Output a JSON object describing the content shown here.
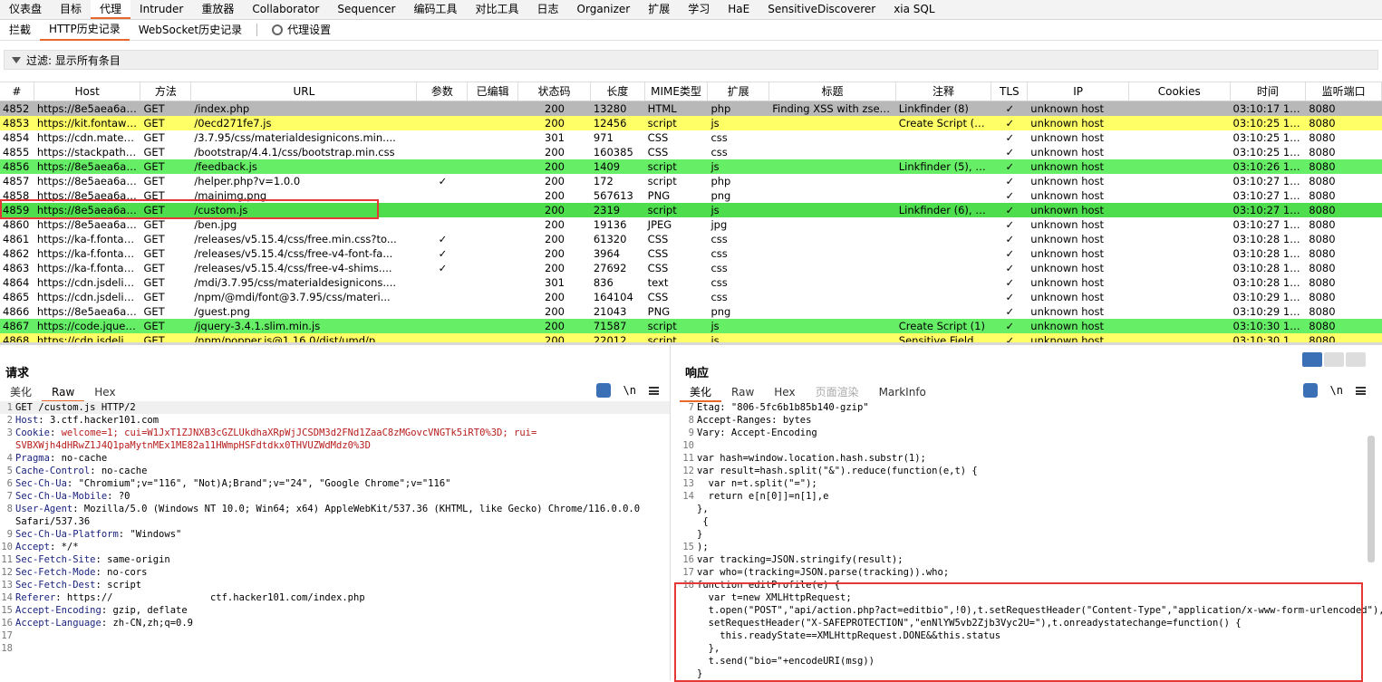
{
  "topnav": [
    "仪表盘",
    "目标",
    "代理",
    "Intruder",
    "重放器",
    "Collaborator",
    "Sequencer",
    "编码工具",
    "对比工具",
    "日志",
    "Organizer",
    "扩展",
    "学习",
    "HaE",
    "SensitiveDiscoverer",
    "xia SQL"
  ],
  "subnav": {
    "intercept": "拦截",
    "http_history": "HTTP历史记录",
    "ws_history": "WebSocket历史记录",
    "proxy_settings": "代理设置"
  },
  "filter": {
    "label": "过滤: 显示所有条目"
  },
  "table": {
    "headers": [
      "#",
      "Host",
      "方法",
      "URL",
      "参数",
      "已编辑",
      "状态码",
      "长度",
      "MIME类型",
      "扩展",
      "标题",
      "注释",
      "TLS",
      "IP",
      "Cookies",
      "时间",
      "监听端口"
    ],
    "rows": [
      {
        "id": "4852",
        "host": "https://8e5aea6af6...",
        "method": "GET",
        "url": "/index.php",
        "params": "",
        "edited": "",
        "status": "200",
        "length": "13280",
        "mime": "HTML",
        "ext": "php",
        "title": "Finding XSS with zsean...",
        "comment": "Linkfinder (8)",
        "tls": "✓",
        "ip": "unknown host",
        "cookies": "",
        "time": "03:10:17 17 1...",
        "port": "8080",
        "color": "gray"
      },
      {
        "id": "4853",
        "host": "https://kit.fontawes...",
        "method": "GET",
        "url": "/0ecd271fe7.js",
        "params": "",
        "edited": "",
        "status": "200",
        "length": "12456",
        "mime": "script",
        "ext": "js",
        "title": "",
        "comment": "Create Script (1), ...",
        "tls": "✓",
        "ip": "unknown host",
        "cookies": "",
        "time": "03:10:25 17 1...",
        "port": "8080",
        "color": "yellow"
      },
      {
        "id": "4854",
        "host": "https://cdn.materia...",
        "method": "GET",
        "url": "/3.7.95/css/materialdesignicons.min....",
        "params": "",
        "edited": "",
        "status": "301",
        "length": "971",
        "mime": "CSS",
        "ext": "css",
        "title": "",
        "comment": "",
        "tls": "✓",
        "ip": "unknown host",
        "cookies": "",
        "time": "03:10:25 17 1...",
        "port": "8080",
        "color": "white"
      },
      {
        "id": "4855",
        "host": "https://stackpath.b...",
        "method": "GET",
        "url": "/bootstrap/4.4.1/css/bootstrap.min.css",
        "params": "",
        "edited": "",
        "status": "200",
        "length": "160385",
        "mime": "CSS",
        "ext": "css",
        "title": "",
        "comment": "",
        "tls": "✓",
        "ip": "unknown host",
        "cookies": "",
        "time": "03:10:25 17 1...",
        "port": "8080",
        "color": "white"
      },
      {
        "id": "4856",
        "host": "https://8e5aea6af6...",
        "method": "GET",
        "url": "/feedback.js",
        "params": "",
        "edited": "",
        "status": "200",
        "length": "1409",
        "mime": "script",
        "ext": "js",
        "title": "",
        "comment": "Linkfinder (5), Us...",
        "tls": "✓",
        "ip": "unknown host",
        "cookies": "",
        "time": "03:10:26 17 1...",
        "port": "8080",
        "color": "green"
      },
      {
        "id": "4857",
        "host": "https://8e5aea6af6...",
        "method": "GET",
        "url": "/helper.php?v=1.0.0",
        "params": "✓",
        "edited": "",
        "status": "200",
        "length": "172",
        "mime": "script",
        "ext": "php",
        "title": "",
        "comment": "",
        "tls": "✓",
        "ip": "unknown host",
        "cookies": "",
        "time": "03:10:27 17 1...",
        "port": "8080",
        "color": "white"
      },
      {
        "id": "4858",
        "host": "https://8e5aea6af6...",
        "method": "GET",
        "url": "/mainimg.png",
        "params": "",
        "edited": "",
        "status": "200",
        "length": "567613",
        "mime": "PNG",
        "ext": "png",
        "title": "",
        "comment": "",
        "tls": "✓",
        "ip": "unknown host",
        "cookies": "",
        "time": "03:10:27 17 1...",
        "port": "8080",
        "color": "white"
      },
      {
        "id": "4859",
        "host": "https://8e5aea6af6...",
        "method": "GET",
        "url": "/custom.js",
        "params": "",
        "edited": "",
        "status": "200",
        "length": "2319",
        "mime": "script",
        "ext": "js",
        "title": "",
        "comment": "Linkfinder (6), Us...",
        "tls": "✓",
        "ip": "unknown host",
        "cookies": "",
        "time": "03:10:27 17 1...",
        "port": "8080",
        "color": "green2"
      },
      {
        "id": "4860",
        "host": "https://8e5aea6af6...",
        "method": "GET",
        "url": "/ben.jpg",
        "params": "",
        "edited": "",
        "status": "200",
        "length": "19136",
        "mime": "JPEG",
        "ext": "jpg",
        "title": "",
        "comment": "",
        "tls": "✓",
        "ip": "unknown host",
        "cookies": "",
        "time": "03:10:27 17 1...",
        "port": "8080",
        "color": "white"
      },
      {
        "id": "4861",
        "host": "https://ka-f.fontaw...",
        "method": "GET",
        "url": "/releases/v5.15.4/css/free.min.css?to...",
        "params": "✓",
        "edited": "",
        "status": "200",
        "length": "61320",
        "mime": "CSS",
        "ext": "css",
        "title": "",
        "comment": "",
        "tls": "✓",
        "ip": "unknown host",
        "cookies": "",
        "time": "03:10:28 17 1...",
        "port": "8080",
        "color": "white"
      },
      {
        "id": "4862",
        "host": "https://ka-f.fontaw...",
        "method": "GET",
        "url": "/releases/v5.15.4/css/free-v4-font-fa...",
        "params": "✓",
        "edited": "",
        "status": "200",
        "length": "3964",
        "mime": "CSS",
        "ext": "css",
        "title": "",
        "comment": "",
        "tls": "✓",
        "ip": "unknown host",
        "cookies": "",
        "time": "03:10:28 17 1...",
        "port": "8080",
        "color": "white"
      },
      {
        "id": "4863",
        "host": "https://ka-f.fontaw...",
        "method": "GET",
        "url": "/releases/v5.15.4/css/free-v4-shims....",
        "params": "✓",
        "edited": "",
        "status": "200",
        "length": "27692",
        "mime": "CSS",
        "ext": "css",
        "title": "",
        "comment": "",
        "tls": "✓",
        "ip": "unknown host",
        "cookies": "",
        "time": "03:10:28 17 1...",
        "port": "8080",
        "color": "white"
      },
      {
        "id": "4864",
        "host": "https://cdn.jsdelivr....",
        "method": "GET",
        "url": "/mdi/3.7.95/css/materialdesignicons....",
        "params": "",
        "edited": "",
        "status": "301",
        "length": "836",
        "mime": "text",
        "ext": "css",
        "title": "",
        "comment": "",
        "tls": "✓",
        "ip": "unknown host",
        "cookies": "",
        "time": "03:10:28 17 1...",
        "port": "8080",
        "color": "white"
      },
      {
        "id": "4865",
        "host": "https://cdn.jsdelivr....",
        "method": "GET",
        "url": "/npm/@mdi/font@3.7.95/css/materi...",
        "params": "",
        "edited": "",
        "status": "200",
        "length": "164104",
        "mime": "CSS",
        "ext": "css",
        "title": "",
        "comment": "",
        "tls": "✓",
        "ip": "unknown host",
        "cookies": "",
        "time": "03:10:29 17 1...",
        "port": "8080",
        "color": "white"
      },
      {
        "id": "4866",
        "host": "https://8e5aea6af6...",
        "method": "GET",
        "url": "/guest.png",
        "params": "",
        "edited": "",
        "status": "200",
        "length": "21043",
        "mime": "PNG",
        "ext": "png",
        "title": "",
        "comment": "",
        "tls": "✓",
        "ip": "unknown host",
        "cookies": "",
        "time": "03:10:29 17 1...",
        "port": "8080",
        "color": "white"
      },
      {
        "id": "4867",
        "host": "https://code.jquery...",
        "method": "GET",
        "url": "/jquery-3.4.1.slim.min.js",
        "params": "",
        "edited": "",
        "status": "200",
        "length": "71587",
        "mime": "script",
        "ext": "js",
        "title": "",
        "comment": "Create Script (1)",
        "tls": "✓",
        "ip": "unknown host",
        "cookies": "",
        "time": "03:10:30 17 1...",
        "port": "8080",
        "color": "green"
      },
      {
        "id": "4868",
        "host": "https://cdn.jsdelivr...",
        "method": "GET",
        "url": "/npm/popper.js@1.16.0/dist/umd/p...",
        "params": "",
        "edited": "",
        "status": "200",
        "length": "22012",
        "mime": "script",
        "ext": "js",
        "title": "",
        "comment": "Sensitive Field (4...",
        "tls": "✓",
        "ip": "unknown host",
        "cookies": "",
        "time": "03:10:30 17 1...",
        "port": "8080",
        "color": "yellow"
      }
    ]
  },
  "request": {
    "title": "请求",
    "tabs": [
      "美化",
      "Raw",
      "Hex"
    ],
    "active_tab": "Raw",
    "wrap_label": "\\n",
    "lines": [
      {
        "n": "1",
        "key": "",
        "val": "GET /custom.js HTTP/2"
      },
      {
        "n": "2",
        "key": "Host",
        "val": "3.ctf.hacker101.com"
      },
      {
        "n": "3",
        "key": "Cookie",
        "val": "welcome=1; cui=W1JxT1ZJNXB3cGZLUkdhaXRpWjJCSDM3d2FNd1ZaaC8zMGovcVNGTk5iRT0%3D; rui="
      },
      {
        "n": "",
        "key": "",
        "val": "SVBXWjh4dHRwZ1J4Q1paMytnMEx1ME82a11HWmpHSFdtdkx0THVUZWdMdz0%3D"
      },
      {
        "n": "4",
        "key": "Pragma",
        "val": "no-cache"
      },
      {
        "n": "5",
        "key": "Cache-Control",
        "val": "no-cache"
      },
      {
        "n": "6",
        "key": "Sec-Ch-Ua",
        "val": "\"Chromium\";v=\"116\", \"Not)A;Brand\";v=\"24\", \"Google Chrome\";v=\"116\""
      },
      {
        "n": "7",
        "key": "Sec-Ch-Ua-Mobile",
        "val": "?0"
      },
      {
        "n": "8",
        "key": "User-Agent",
        "val": "Mozilla/5.0 (Windows NT 10.0; Win64; x64) AppleWebKit/537.36 (KHTML, like Gecko) Chrome/116.0.0.0"
      },
      {
        "n": "",
        "key": "",
        "val": "Safari/537.36"
      },
      {
        "n": "9",
        "key": "Sec-Ch-Ua-Platform",
        "val": "\"Windows\""
      },
      {
        "n": "10",
        "key": "Accept",
        "val": "*/*"
      },
      {
        "n": "11",
        "key": "Sec-Fetch-Site",
        "val": "same-origin"
      },
      {
        "n": "12",
        "key": "Sec-Fetch-Mode",
        "val": "no-cors"
      },
      {
        "n": "13",
        "key": "Sec-Fetch-Dest",
        "val": "script"
      },
      {
        "n": "14",
        "key": "Referer",
        "val": "https://                 ctf.hacker101.com/index.php"
      },
      {
        "n": "15",
        "key": "Accept-Encoding",
        "val": "gzip, deflate"
      },
      {
        "n": "16",
        "key": "Accept-Language",
        "val": "zh-CN,zh;q=0.9"
      },
      {
        "n": "17",
        "key": "",
        "val": ""
      },
      {
        "n": "18",
        "key": "",
        "val": ""
      }
    ]
  },
  "response": {
    "title": "响应",
    "tabs": [
      "美化",
      "Raw",
      "Hex",
      "页面渲染",
      "MarkInfo"
    ],
    "active_tab": "美化",
    "wrap_label": "\\n",
    "lines": [
      {
        "n": "7",
        "text": "Etag: \"806-5fc6b1b85b140-gzip\""
      },
      {
        "n": "8",
        "text": "Accept-Ranges: bytes"
      },
      {
        "n": "9",
        "text": "Vary: Accept-Encoding"
      },
      {
        "n": "10",
        "text": ""
      },
      {
        "n": "11",
        "text": "var hash=window.location.hash.substr(1);"
      },
      {
        "n": "12",
        "text": "var result=hash.split(\"&\").reduce(function(e,t) {"
      },
      {
        "n": "13",
        "text": "  var n=t.split(\"=\");"
      },
      {
        "n": "14",
        "text": "  return e[n[0]]=n[1],e"
      },
      {
        "n": "",
        "text": "},"
      },
      {
        "n": "",
        "text": " {"
      },
      {
        "n": "",
        "text": "}"
      },
      {
        "n": "15",
        "text": ");"
      },
      {
        "n": "16",
        "text": "var tracking=JSON.stringify(result);"
      },
      {
        "n": "17",
        "text": "var who=(tracking=JSON.parse(tracking)).who;"
      },
      {
        "n": "18",
        "text": "function editProfile(e) {"
      },
      {
        "n": "",
        "text": "  var t=new XMLHttpRequest;"
      },
      {
        "n": "",
        "text": "  t.open(\"POST\",\"api/action.php?act=editbio\",!0),t.setRequestHeader(\"Content-Type\",\"application/x-www-form-urlencoded\"),t."
      },
      {
        "n": "",
        "text": "  setRequestHeader(\"X-SAFEPROTECTION\",\"enNlYW5vb2Zjb3Vyc2U=\"),t.onreadystatechange=function() {"
      },
      {
        "n": "",
        "text": "    this.readyState==XMLHttpRequest.DONE&&this.status"
      },
      {
        "n": "",
        "text": "  },"
      },
      {
        "n": "",
        "text": "  t.send(\"bio=\"+encodeURI(msg))"
      },
      {
        "n": "",
        "text": "}"
      }
    ]
  }
}
